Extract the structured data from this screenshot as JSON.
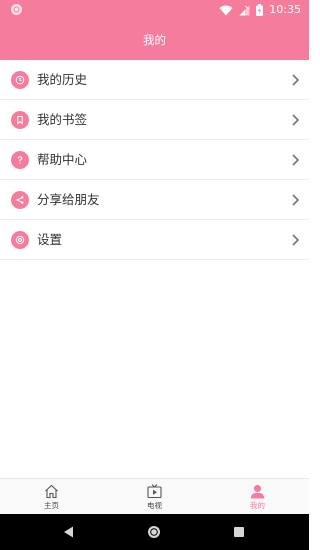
{
  "statusbar": {
    "time": "10:35",
    "icons": [
      "app-notification-icon",
      "wifi-icon",
      "signal-icon",
      "battery-icon"
    ]
  },
  "appbar": {
    "title": "我的"
  },
  "menu": {
    "items": [
      {
        "label": "我的历史",
        "icon": "history-icon"
      },
      {
        "label": "我的书签",
        "icon": "bookmark-icon"
      },
      {
        "label": "帮助中心",
        "icon": "help-icon"
      },
      {
        "label": "分享给朋友",
        "icon": "share-icon"
      },
      {
        "label": "设置",
        "icon": "settings-icon"
      }
    ]
  },
  "tabbar": {
    "tabs": [
      {
        "label": "主页",
        "icon": "home-icon",
        "active": false
      },
      {
        "label": "电视",
        "icon": "tv-icon",
        "active": false
      },
      {
        "label": "我的",
        "icon": "person-icon",
        "active": true
      }
    ]
  },
  "colors": {
    "accent": "#f67c9e",
    "text": "#333333",
    "divider": "#ececec",
    "tabbar_bg": "#f9f9f9",
    "navbar_bg": "#000000"
  }
}
